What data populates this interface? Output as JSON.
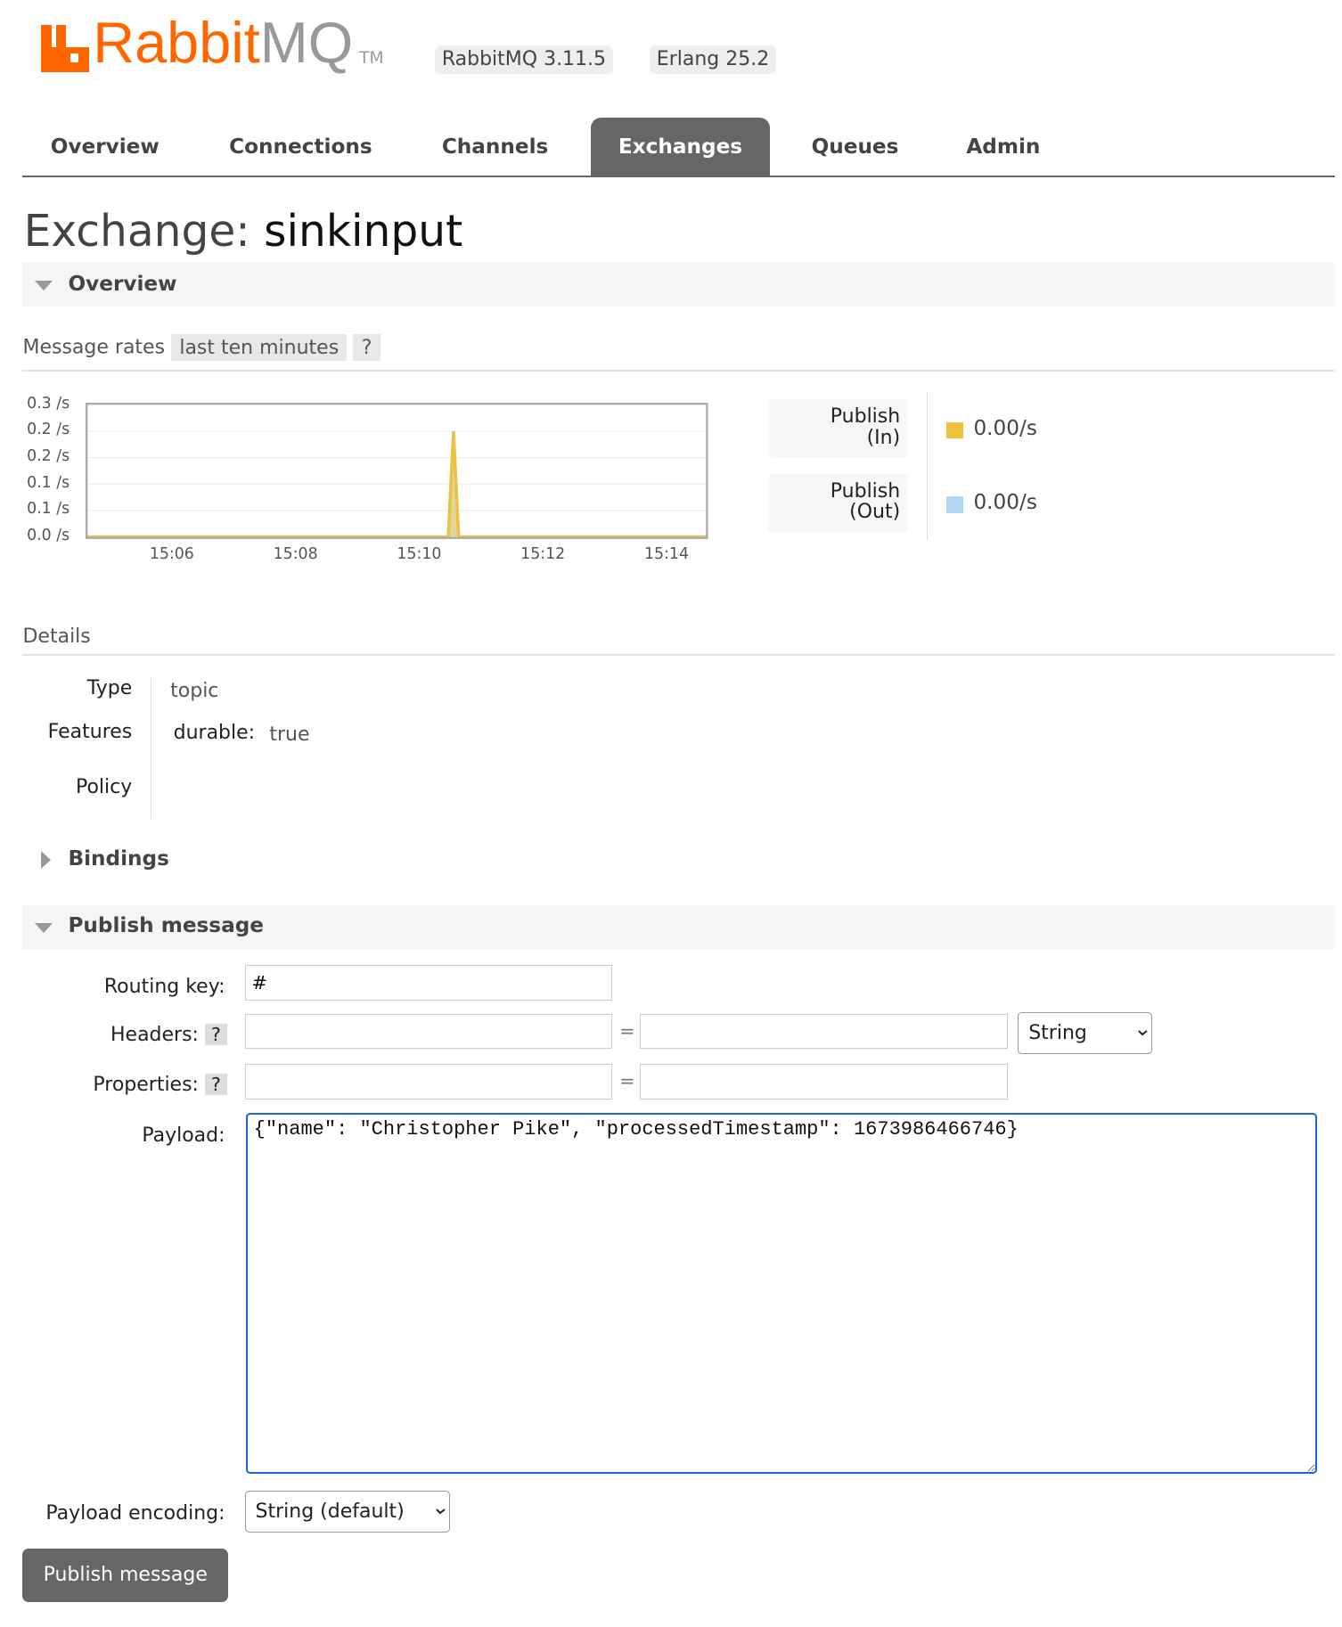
{
  "header": {
    "logo_text_rabbit": "Rabbit",
    "logo_text_mq": "MQ",
    "logo_tm": "TM",
    "version_badge": "RabbitMQ 3.11.5",
    "erlang_badge": "Erlang 25.2",
    "brand_color": "#ff6600"
  },
  "nav": {
    "tabs": [
      {
        "label": "Overview"
      },
      {
        "label": "Connections"
      },
      {
        "label": "Channels"
      },
      {
        "label": "Exchanges",
        "active": true
      },
      {
        "label": "Queues"
      },
      {
        "label": "Admin"
      }
    ]
  },
  "page": {
    "title_prefix": "Exchange:",
    "title_name": "sinkinput"
  },
  "overview": {
    "section_label": "Overview",
    "message_rates_label": "Message rates",
    "range_label": "last ten minutes",
    "help": "?",
    "legend": [
      {
        "line1": "Publish",
        "line2": "(In)",
        "rate": "0.00/s",
        "color": "#edc240"
      },
      {
        "line1": "Publish",
        "line2": "(Out)",
        "rate": "0.00/s",
        "color": "#afd8f8"
      }
    ]
  },
  "chart_data": {
    "type": "line",
    "y_tick_labels": [
      "0.3 /s",
      "0.2 /s",
      "0.2 /s",
      "0.1 /s",
      "0.1 /s",
      "0.0 /s"
    ],
    "x_tick_labels": [
      "15:06",
      "15:08",
      "15:10",
      "15:12",
      "15:14"
    ],
    "ylim": [
      0,
      0.25
    ],
    "xlim": [
      "15:04:35",
      "15:14:35"
    ],
    "grid": true,
    "series": [
      {
        "name": "Publish (In)",
        "color": "#edc240",
        "x": [
          "15:04:35",
          "15:10:25",
          "15:10:30",
          "15:10:35",
          "15:14:35"
        ],
        "y": [
          0,
          0,
          0.2,
          0,
          0
        ]
      },
      {
        "name": "Publish (Out)",
        "color": "#afd8f8",
        "x": [
          "15:04:35",
          "15:10:25",
          "15:10:30",
          "15:10:35",
          "15:14:35"
        ],
        "y": [
          0,
          0,
          0.2,
          0,
          0
        ]
      }
    ]
  },
  "details": {
    "heading": "Details",
    "type_label": "Type",
    "type_value": "topic",
    "features_label": "Features",
    "durable_label": "durable:",
    "durable_value": "true",
    "policy_label": "Policy"
  },
  "bindings": {
    "section_label": "Bindings"
  },
  "publish": {
    "section_label": "Publish message",
    "routing_key_label": "Routing key:",
    "routing_key_value": "#",
    "headers_label": "Headers:",
    "headers_type": "String",
    "properties_label": "Properties:",
    "help": "?",
    "equals": "=",
    "payload_label": "Payload:",
    "payload_value": "{\"name\": \"Christopher Pike\", \"processedTimestamp\": 1673986466746}",
    "encoding_label": "Payload encoding:",
    "encoding_value": "String (default)",
    "button_label": "Publish message"
  }
}
